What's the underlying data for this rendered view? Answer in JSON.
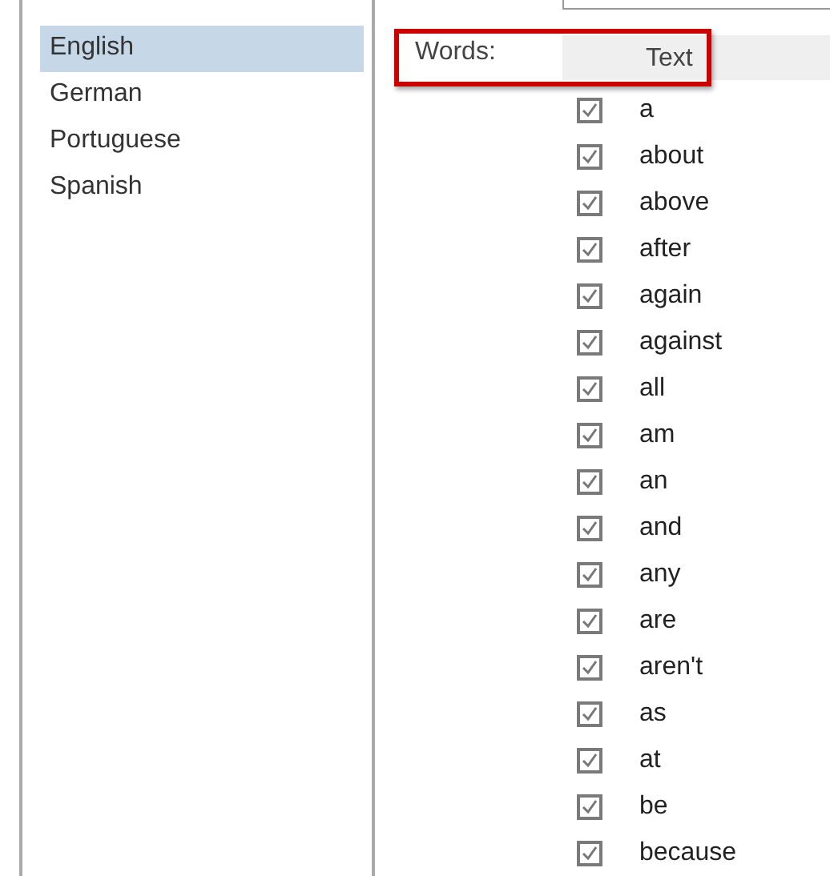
{
  "languages": [
    {
      "label": "English",
      "selected": true
    },
    {
      "label": "German",
      "selected": false
    },
    {
      "label": "Portuguese",
      "selected": false
    },
    {
      "label": "Spanish",
      "selected": false
    }
  ],
  "words_header": {
    "label": "Words:",
    "column": "Text",
    "highlighted": true
  },
  "words": [
    {
      "text": "a",
      "checked": true
    },
    {
      "text": "about",
      "checked": true
    },
    {
      "text": "above",
      "checked": true
    },
    {
      "text": "after",
      "checked": true
    },
    {
      "text": "again",
      "checked": true
    },
    {
      "text": "against",
      "checked": true
    },
    {
      "text": "all",
      "checked": true
    },
    {
      "text": "am",
      "checked": true
    },
    {
      "text": "an",
      "checked": true
    },
    {
      "text": "and",
      "checked": true
    },
    {
      "text": "any",
      "checked": true
    },
    {
      "text": "are",
      "checked": true
    },
    {
      "text": "aren't",
      "checked": true
    },
    {
      "text": "as",
      "checked": true
    },
    {
      "text": "at",
      "checked": true
    },
    {
      "text": "be",
      "checked": true
    },
    {
      "text": "because",
      "checked": true
    }
  ]
}
